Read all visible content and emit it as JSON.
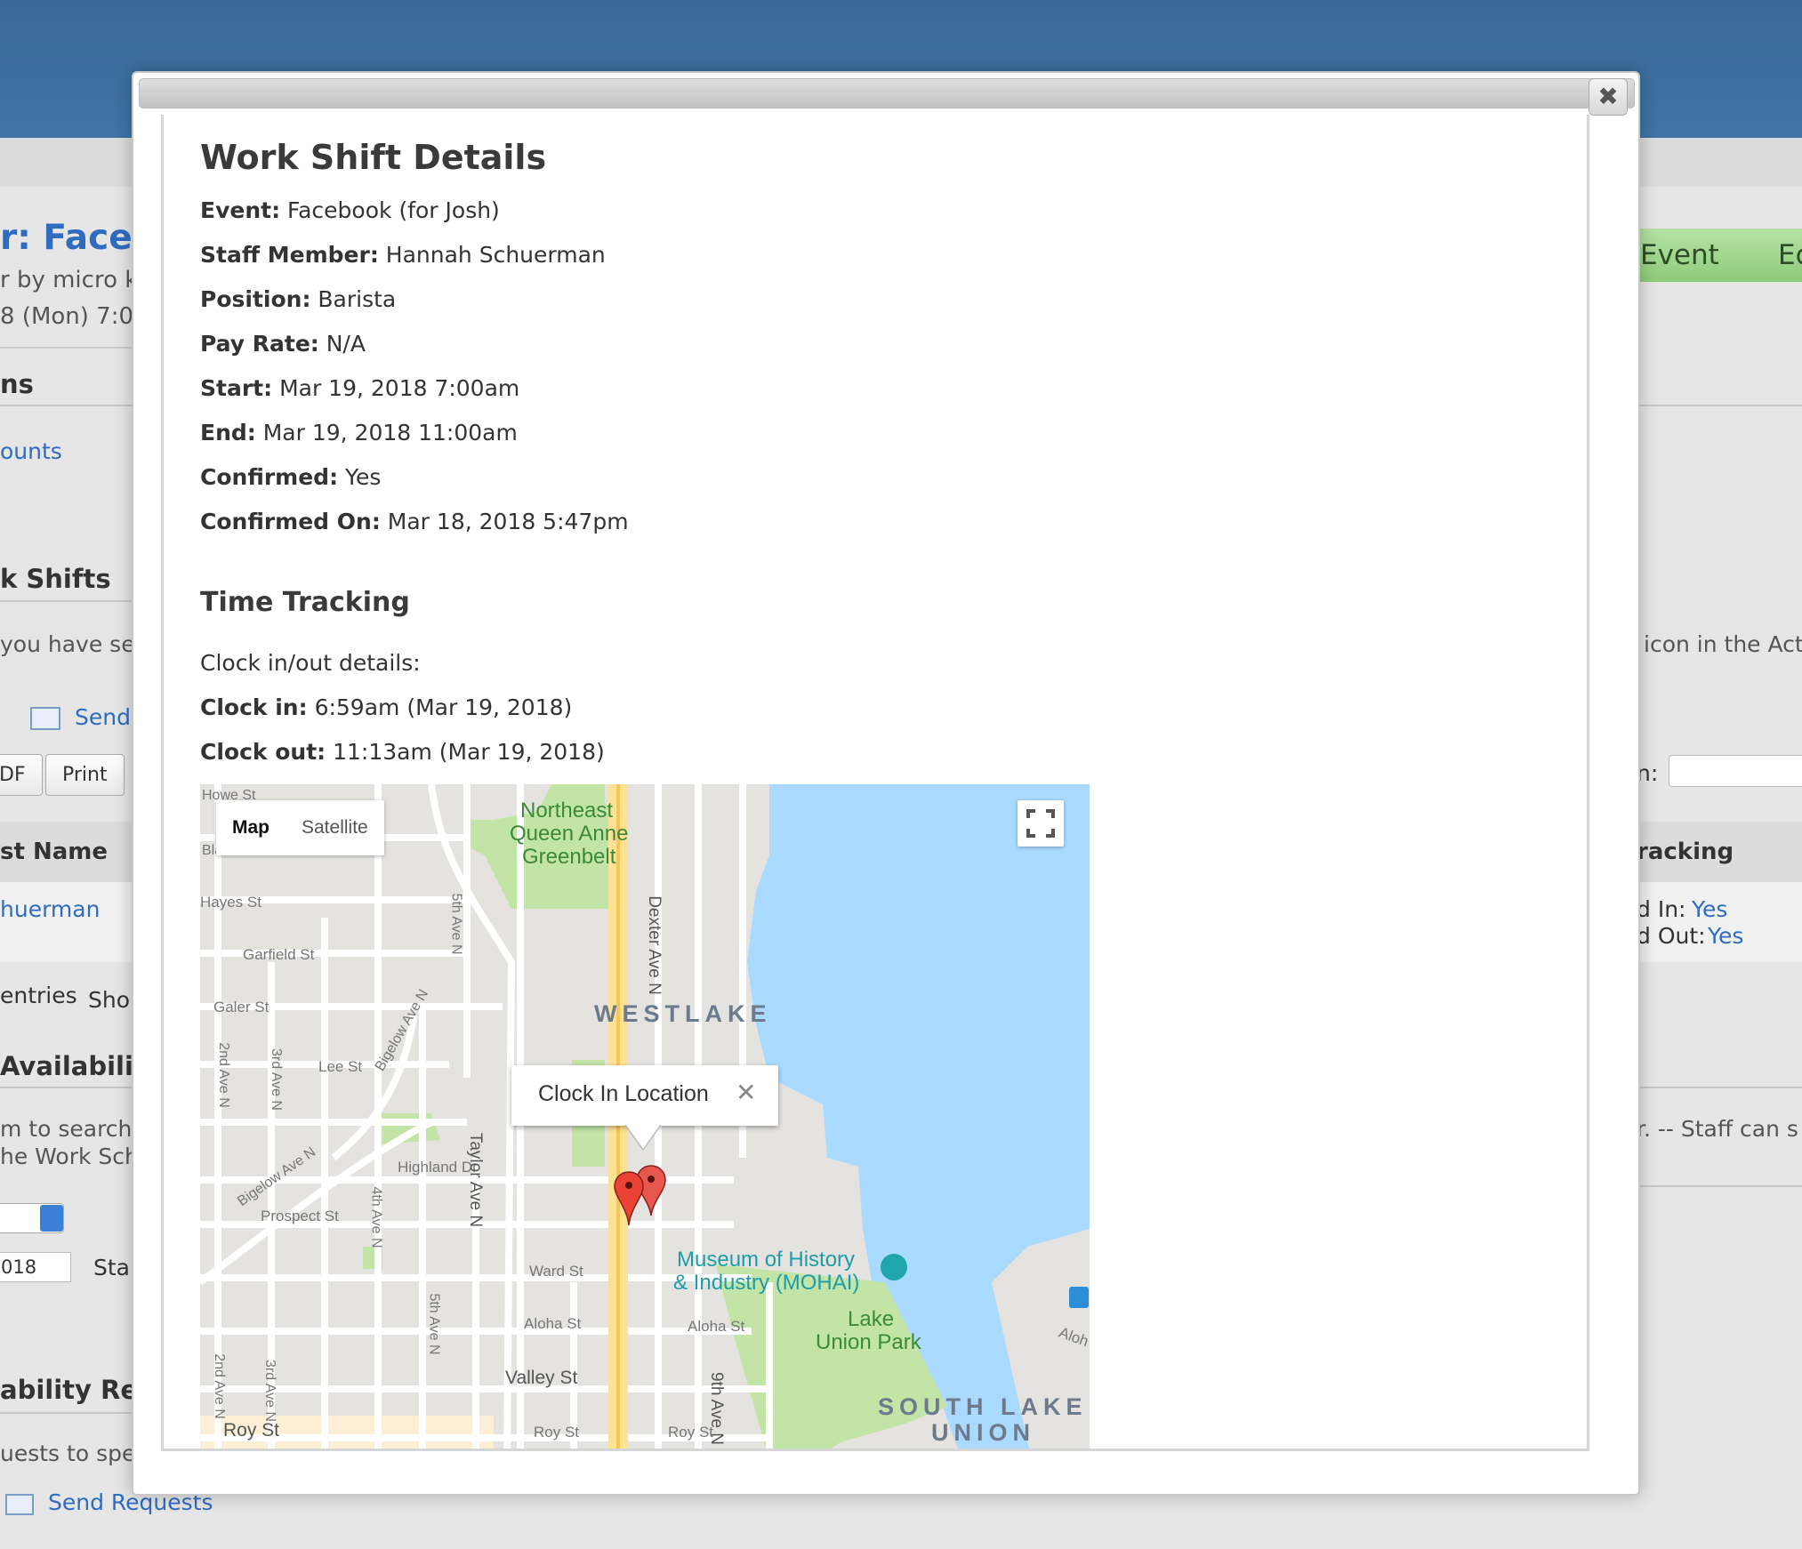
{
  "background": {
    "event_title_fragment": "r: Faceb",
    "subtitle_fragment": "r by micro k",
    "date_fragment": "8 (Mon) 7:0",
    "section1_fragment": "ns",
    "accounts_fragment": "ounts",
    "shifts_header_fragment": "k Shifts",
    "instruction_fragment": "you have sel",
    "send_label": "Send",
    "pdf_fragment": "DF",
    "print_label": "Print",
    "col_name_fragment": "st Name",
    "row_name_fragment": "huerman",
    "entries_fragment": "entries",
    "show_fragment": "Sho",
    "availability_fragment": "Availabili",
    "search_fragment1": "m to search",
    "search_fragment2": "he Work Sch",
    "date_input_fragment": "018",
    "sta_fragment": "Sta",
    "ability_req_fragment": "ability Re",
    "requests_fragment": "uests to spec",
    "send_requests_label": "Send Requests",
    "event_btn_fragment": "Event",
    "edit_btn_fragment": "Ec",
    "icon_text_fragment": "icon in the Acti",
    "colon_fragment": "n:",
    "tracking_fragment": "racking",
    "clocked_in_label": "d In:",
    "clocked_in_value": "Yes",
    "clocked_out_label": "d Out:",
    "clocked_out_value": "Yes",
    "staff_can_fragment": "r. -- Staff can s"
  },
  "modal": {
    "close_glyph": "✖",
    "title": "Work Shift Details",
    "fields": [
      {
        "label": "Event:",
        "value": "Facebook (for Josh)"
      },
      {
        "label": "Staff Member:",
        "value": "Hannah Schuerman"
      },
      {
        "label": "Position:",
        "value": "Barista"
      },
      {
        "label": "Pay Rate:",
        "value": "N/A"
      },
      {
        "label": "Start:",
        "value": "Mar 19, 2018 7:00am"
      },
      {
        "label": "End:",
        "value": "Mar 19, 2018 11:00am"
      },
      {
        "label": "Confirmed:",
        "value": "Yes"
      },
      {
        "label": "Confirmed On:",
        "value": "Mar 18, 2018 5:47pm"
      }
    ],
    "time_tracking_title": "Time Tracking",
    "clock_details_label": "Clock in/out details:",
    "clock_in_label": "Clock in:",
    "clock_in_value": "6:59am (Mar 19, 2018)",
    "clock_out_label": "Clock out:",
    "clock_out_value": "11:13am (Mar 19, 2018)"
  },
  "map": {
    "map_type_map": "Map",
    "map_type_satellite": "Satellite",
    "info_window_title": "Clock In Location",
    "info_window_close": "✕",
    "labels": {
      "howe": "Howe St",
      "blaine": "Blaine St",
      "hayes": "Hayes St",
      "garfield": "Garfield St",
      "galer": "Galer St",
      "lee": "Lee St",
      "highland": "Highland Dr",
      "prospect": "Prospect St",
      "ward": "Ward St",
      "aloha1": "Aloha St",
      "aloha2": "Aloha St",
      "valley": "Valley St",
      "roy1": "Roy St",
      "roy2": "Roy St",
      "roy3": "Roy St",
      "ave2n_a": "2nd Ave N",
      "ave3n_a": "3rd Ave N",
      "ave2n_b": "2nd Ave N",
      "ave3n_b": "3rd Ave N",
      "ave4n": "4th Ave N",
      "ave5n_a": "5th Ave N",
      "ave5n_b": "5th Ave N",
      "taylor": "Taylor Ave N",
      "dexter": "Dexter Ave N",
      "ave9n": "9th Ave N",
      "bigelow1": "Bigelow Ave N",
      "bigelow2": "Bigelow Ave N",
      "ne_qa_1": "Northeast",
      "ne_qa_2": "Queen Anne",
      "ne_qa_3": "Greenbelt",
      "westlake": "WESTLAKE",
      "mohai1": "Museum of History",
      "mohai2": "& Industry (MOHAI)",
      "lup1": "Lake",
      "lup2": "Union Park",
      "slu1": "SOUTH LAKE",
      "slu2": "UNION",
      "aloh": "Aloh"
    }
  }
}
